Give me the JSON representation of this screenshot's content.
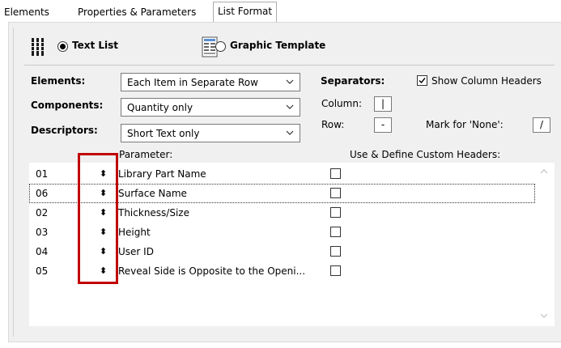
{
  "tabs": [
    {
      "label": "Elements"
    },
    {
      "label": "Properties & Parameters"
    },
    {
      "label": "List Format"
    }
  ],
  "format": {
    "text_list_label": "Text List",
    "graphic_template_label": "Graphic Template",
    "selected": "Text List"
  },
  "fields": {
    "elements_label": "Elements:",
    "elements_value": "Each Item in Separate Row",
    "components_label": "Components:",
    "components_value": "Quantity only",
    "descriptors_label": "Descriptors:",
    "descriptors_value": "Short Text only"
  },
  "separators": {
    "title": "Separators:",
    "column_label": "Column:",
    "column_value": "|",
    "row_label": "Row:",
    "row_value": "-",
    "mark_none_label": "Mark for 'None':",
    "mark_none_value": "/",
    "show_headers_label": "Show Column Headers",
    "show_headers_checked": true
  },
  "table": {
    "parameter_header": "Parameter:",
    "custom_headers_header": "Use & Define Custom Headers:",
    "sort_glyph": "⬍",
    "rows": [
      {
        "id": "01",
        "name": "Library Part Name",
        "custom": false
      },
      {
        "id": "06",
        "name": "Surface Name",
        "custom": false
      },
      {
        "id": "02",
        "name": "Thickness/Size",
        "custom": false
      },
      {
        "id": "03",
        "name": "Height",
        "custom": false
      },
      {
        "id": "04",
        "name": "User ID",
        "custom": false
      },
      {
        "id": "05",
        "name": "Reveal Side is Opposite to the Openi...",
        "custom": false
      }
    ]
  },
  "colors": {
    "highlight_box": "#c00000",
    "panel_bg": "#f0f0f0"
  }
}
